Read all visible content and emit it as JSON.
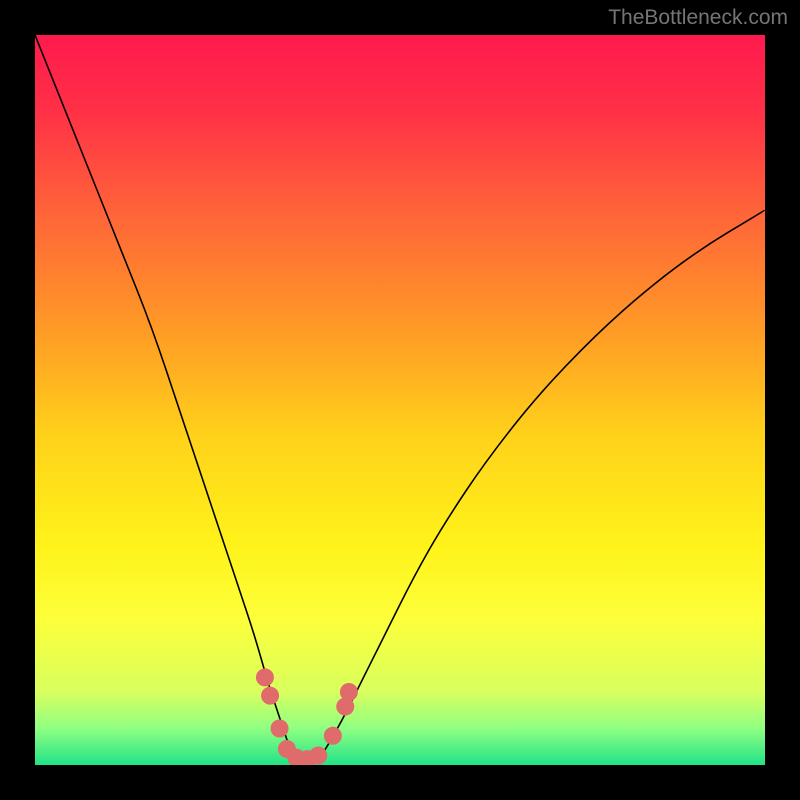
{
  "watermark": "TheBottleneck.com",
  "chart_data": {
    "type": "line",
    "title": "",
    "xlabel": "",
    "ylabel": "",
    "xlim": [
      0,
      100
    ],
    "ylim": [
      0,
      100
    ],
    "background": {
      "type": "vertical-gradient",
      "stops": [
        {
          "offset": 0.0,
          "color": "#ff1a4d"
        },
        {
          "offset": 0.1,
          "color": "#ff2f47"
        },
        {
          "offset": 0.25,
          "color": "#ff6638"
        },
        {
          "offset": 0.4,
          "color": "#ff9926"
        },
        {
          "offset": 0.55,
          "color": "#ffd21a"
        },
        {
          "offset": 0.7,
          "color": "#fff31a"
        },
        {
          "offset": 0.8,
          "color": "#fdff3a"
        },
        {
          "offset": 0.9,
          "color": "#d8ff5e"
        },
        {
          "offset": 0.95,
          "color": "#8fff82"
        },
        {
          "offset": 1.0,
          "color": "#21e388"
        }
      ]
    },
    "series": [
      {
        "name": "bottleneck-curve",
        "color": "#000000",
        "stroke_width": 1.6,
        "x": [
          0,
          4,
          8,
          12,
          16,
          20,
          22,
          24,
          26,
          28,
          30,
          32,
          33,
          34,
          35,
          36,
          37,
          38,
          39,
          40,
          42,
          44,
          48,
          52,
          56,
          62,
          70,
          80,
          90,
          100
        ],
        "y": [
          100,
          90,
          80,
          70,
          60,
          48,
          42,
          36,
          30,
          24,
          18,
          11,
          8,
          5,
          2,
          0.5,
          0.4,
          0.6,
          1.0,
          2.5,
          6,
          10,
          18,
          26,
          33,
          42,
          52,
          62,
          70,
          76
        ]
      }
    ],
    "markers": {
      "name": "highlight-dots",
      "color": "#e06b6b",
      "radius": 9,
      "points": [
        {
          "x": 31.5,
          "y": 12
        },
        {
          "x": 32.2,
          "y": 9.5
        },
        {
          "x": 33.5,
          "y": 5
        },
        {
          "x": 34.5,
          "y": 2.2
        },
        {
          "x": 35.8,
          "y": 1.0
        },
        {
          "x": 37.3,
          "y": 0.8
        },
        {
          "x": 38.8,
          "y": 1.3
        },
        {
          "x": 40.8,
          "y": 4.0
        },
        {
          "x": 42.5,
          "y": 8.0
        },
        {
          "x": 43.0,
          "y": 10.0
        }
      ]
    }
  }
}
